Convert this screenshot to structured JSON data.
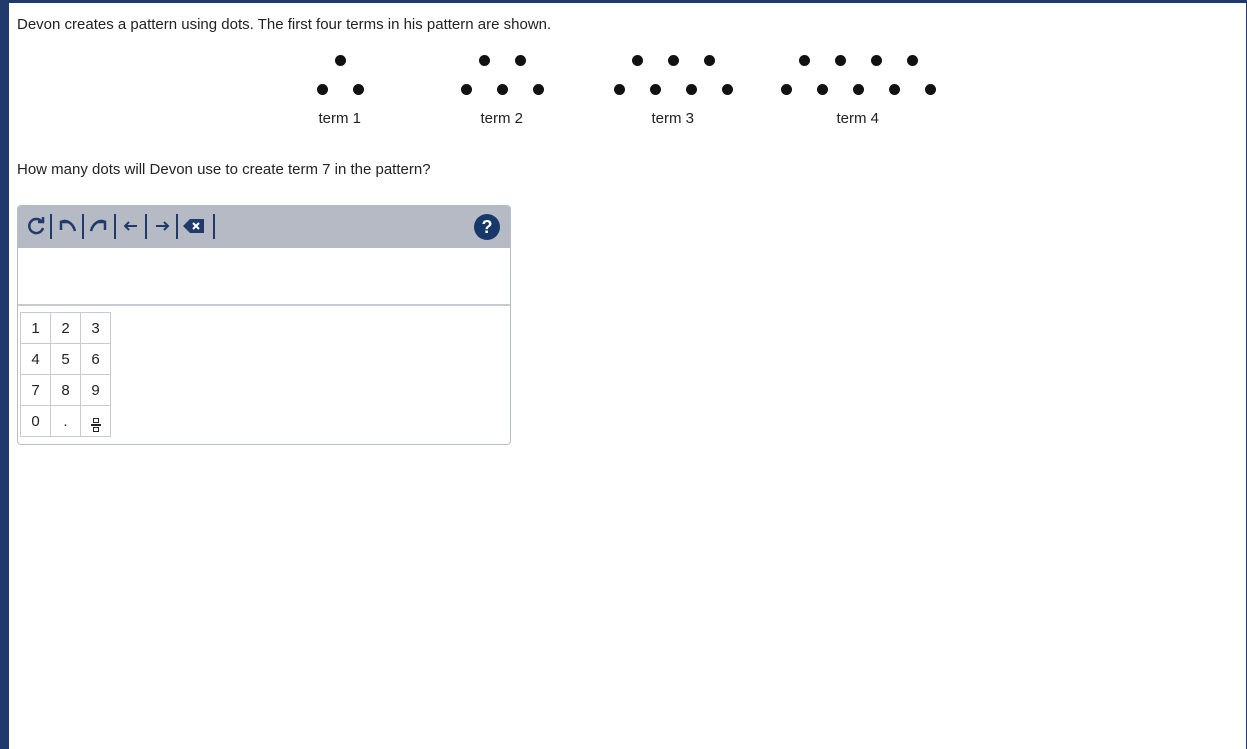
{
  "prompt": "Devon creates a pattern using dots. The first four terms in his pattern are shown.",
  "terms": [
    {
      "label": "term 1",
      "top_row_dots": 1,
      "bottom_row_dots": 2
    },
    {
      "label": "term 2",
      "top_row_dots": 2,
      "bottom_row_dots": 3
    },
    {
      "label": "term 3",
      "top_row_dots": 3,
      "bottom_row_dots": 4
    },
    {
      "label": "term 4",
      "top_row_dots": 4,
      "bottom_row_dots": 5
    }
  ],
  "question": "How many dots will Devon use to create term 7 in the pattern?",
  "editor": {
    "toolbar": [
      "reset-icon",
      "undo-icon",
      "redo-icon",
      "left-arrow-icon",
      "right-arrow-icon",
      "backspace-icon"
    ],
    "help_label": "?",
    "answer_value": "",
    "keypad_rows": [
      [
        "1",
        "2",
        "3"
      ],
      [
        "4",
        "5",
        "6"
      ],
      [
        "7",
        "8",
        "9"
      ],
      [
        "0",
        ".",
        "fraction-icon"
      ]
    ]
  }
}
